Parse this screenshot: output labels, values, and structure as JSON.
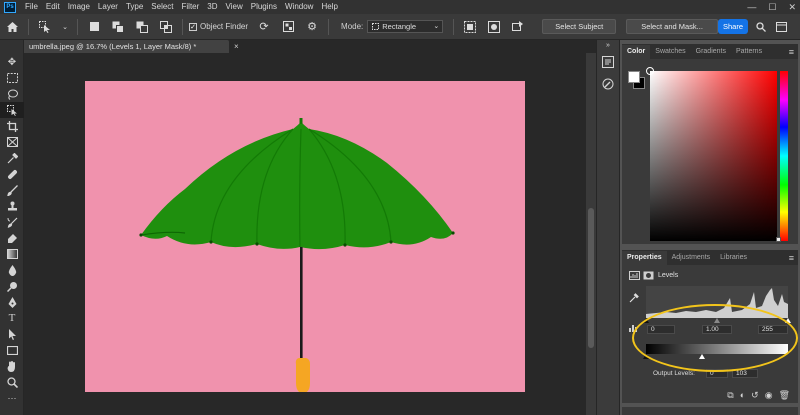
{
  "app": {
    "logo": "Ps",
    "menu": [
      "File",
      "Edit",
      "Image",
      "Layer",
      "Type",
      "Select",
      "Filter",
      "3D",
      "View",
      "Plugins",
      "Window",
      "Help"
    ],
    "window_controls": [
      "—",
      "☐",
      "✕"
    ]
  },
  "options_bar": {
    "object_finder_label": "Object Finder",
    "object_finder_checked": "✓",
    "mode_label": "Mode:",
    "mode_value": "Rectangle",
    "select_subject": "Select Subject",
    "select_and_mask": "Select and Mask...",
    "share": "Share"
  },
  "document": {
    "tab_title": "umbrella.jpeg @ 16.7% (Levels 1, Layer Mask/8) *",
    "close": "×",
    "canvas_color": "#f092ad",
    "umbrella_color": "#1f8f0e",
    "handle_color": "#f5a623"
  },
  "color_panel": {
    "tabs": [
      "Color",
      "Swatches",
      "Gradients",
      "Patterns"
    ],
    "active_tab": "Color",
    "foreground": "#ffffff",
    "background": "#000000"
  },
  "properties_panel": {
    "tabs": [
      "Properties",
      "Adjustments",
      "Libraries"
    ],
    "active_tab": "Properties",
    "adjustment_name": "Levels",
    "input_black": "0",
    "input_gamma": "1.00",
    "input_white": "255",
    "output_label": "Output Levels:",
    "output_black": "0",
    "output_white": "103"
  },
  "annotation": {
    "highlight_color": "#f2c41b"
  }
}
